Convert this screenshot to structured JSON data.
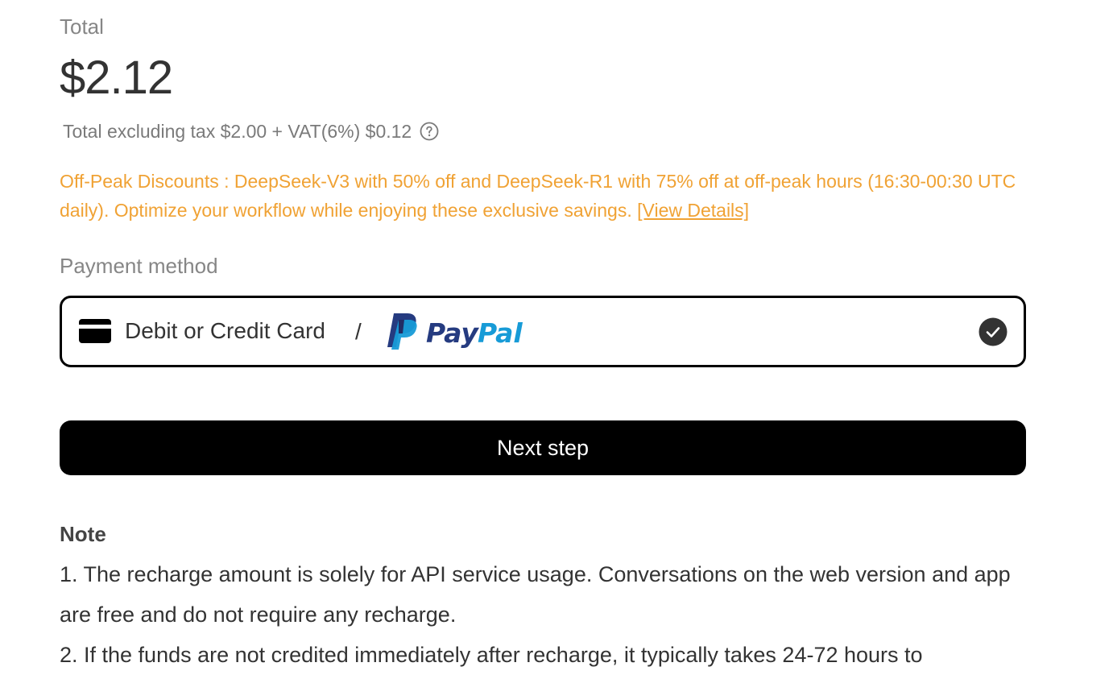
{
  "total": {
    "label": "Total",
    "amount": "$2.12",
    "tax_text": "Total excluding tax $2.00 + VAT(6%) $0.12"
  },
  "promo": {
    "text": "Off-Peak Discounts : DeepSeek-V3 with 50% off and DeepSeek-R1 with 75% off at off-peak hours (16:30-00:30 UTC daily). Optimize your workflow while enjoying these exclusive savings. ",
    "link_label": "[View Details]",
    "color": "#f0a234"
  },
  "payment": {
    "label": "Payment method",
    "option_text": "Debit or Credit Card",
    "separator": "/",
    "paypal_text_pay": "Pay",
    "paypal_text_pal": "Pal",
    "selected": true
  },
  "next_button": {
    "label": "Next step"
  },
  "note": {
    "title": "Note",
    "items": [
      "1. The recharge amount is solely for API service usage. Conversations on the web version and app are free and do not require any recharge.",
      "2. If the funds are not credited immediately after recharge, it typically takes 24-72 hours to"
    ]
  },
  "icons": {
    "help": "question-circle-icon",
    "card": "credit-card-icon",
    "paypal": "paypal-logo",
    "check": "check-circle-icon"
  },
  "colors": {
    "brand_paypal_dark": "#253b80",
    "brand_paypal_light": "#179bd7",
    "button_bg": "#000000"
  }
}
